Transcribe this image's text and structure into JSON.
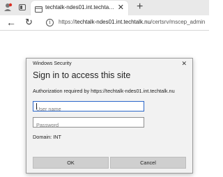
{
  "browser": {
    "tab": {
      "title": "techtalk-ndes01.int.techtalk.nu/ce",
      "close_glyph": "✕"
    },
    "newtab_glyph": "+",
    "nav": {
      "back_glyph": "←",
      "refresh_glyph": "↻",
      "info_glyph": "i",
      "url_prefix": "https://",
      "url_host": "techtalk-ndes01.int.techtalk.nu",
      "url_path": "/certsrv/mscep_admin"
    }
  },
  "dialog": {
    "caption": "Windows Security",
    "close_glyph": "✕",
    "title": "Sign in to access this site",
    "auth_text": "Authorization required by https://techtalk-ndes01.int.techtalk.nu",
    "username_placeholder": "User name",
    "password_placeholder": "Password",
    "domain_text": "Domain: INT",
    "ok_label": "OK",
    "cancel_label": "Cancel"
  },
  "colors": {
    "focus_border": "#2b66c9",
    "button_bg": "#cfcfcf",
    "dialog_bg": "#f2f2f2"
  },
  "icons": {
    "profile": "profile-avatar-icon",
    "tabs": "tab-actions-icon",
    "favicon": "page-favicon-icon",
    "info": "site-info-icon"
  }
}
